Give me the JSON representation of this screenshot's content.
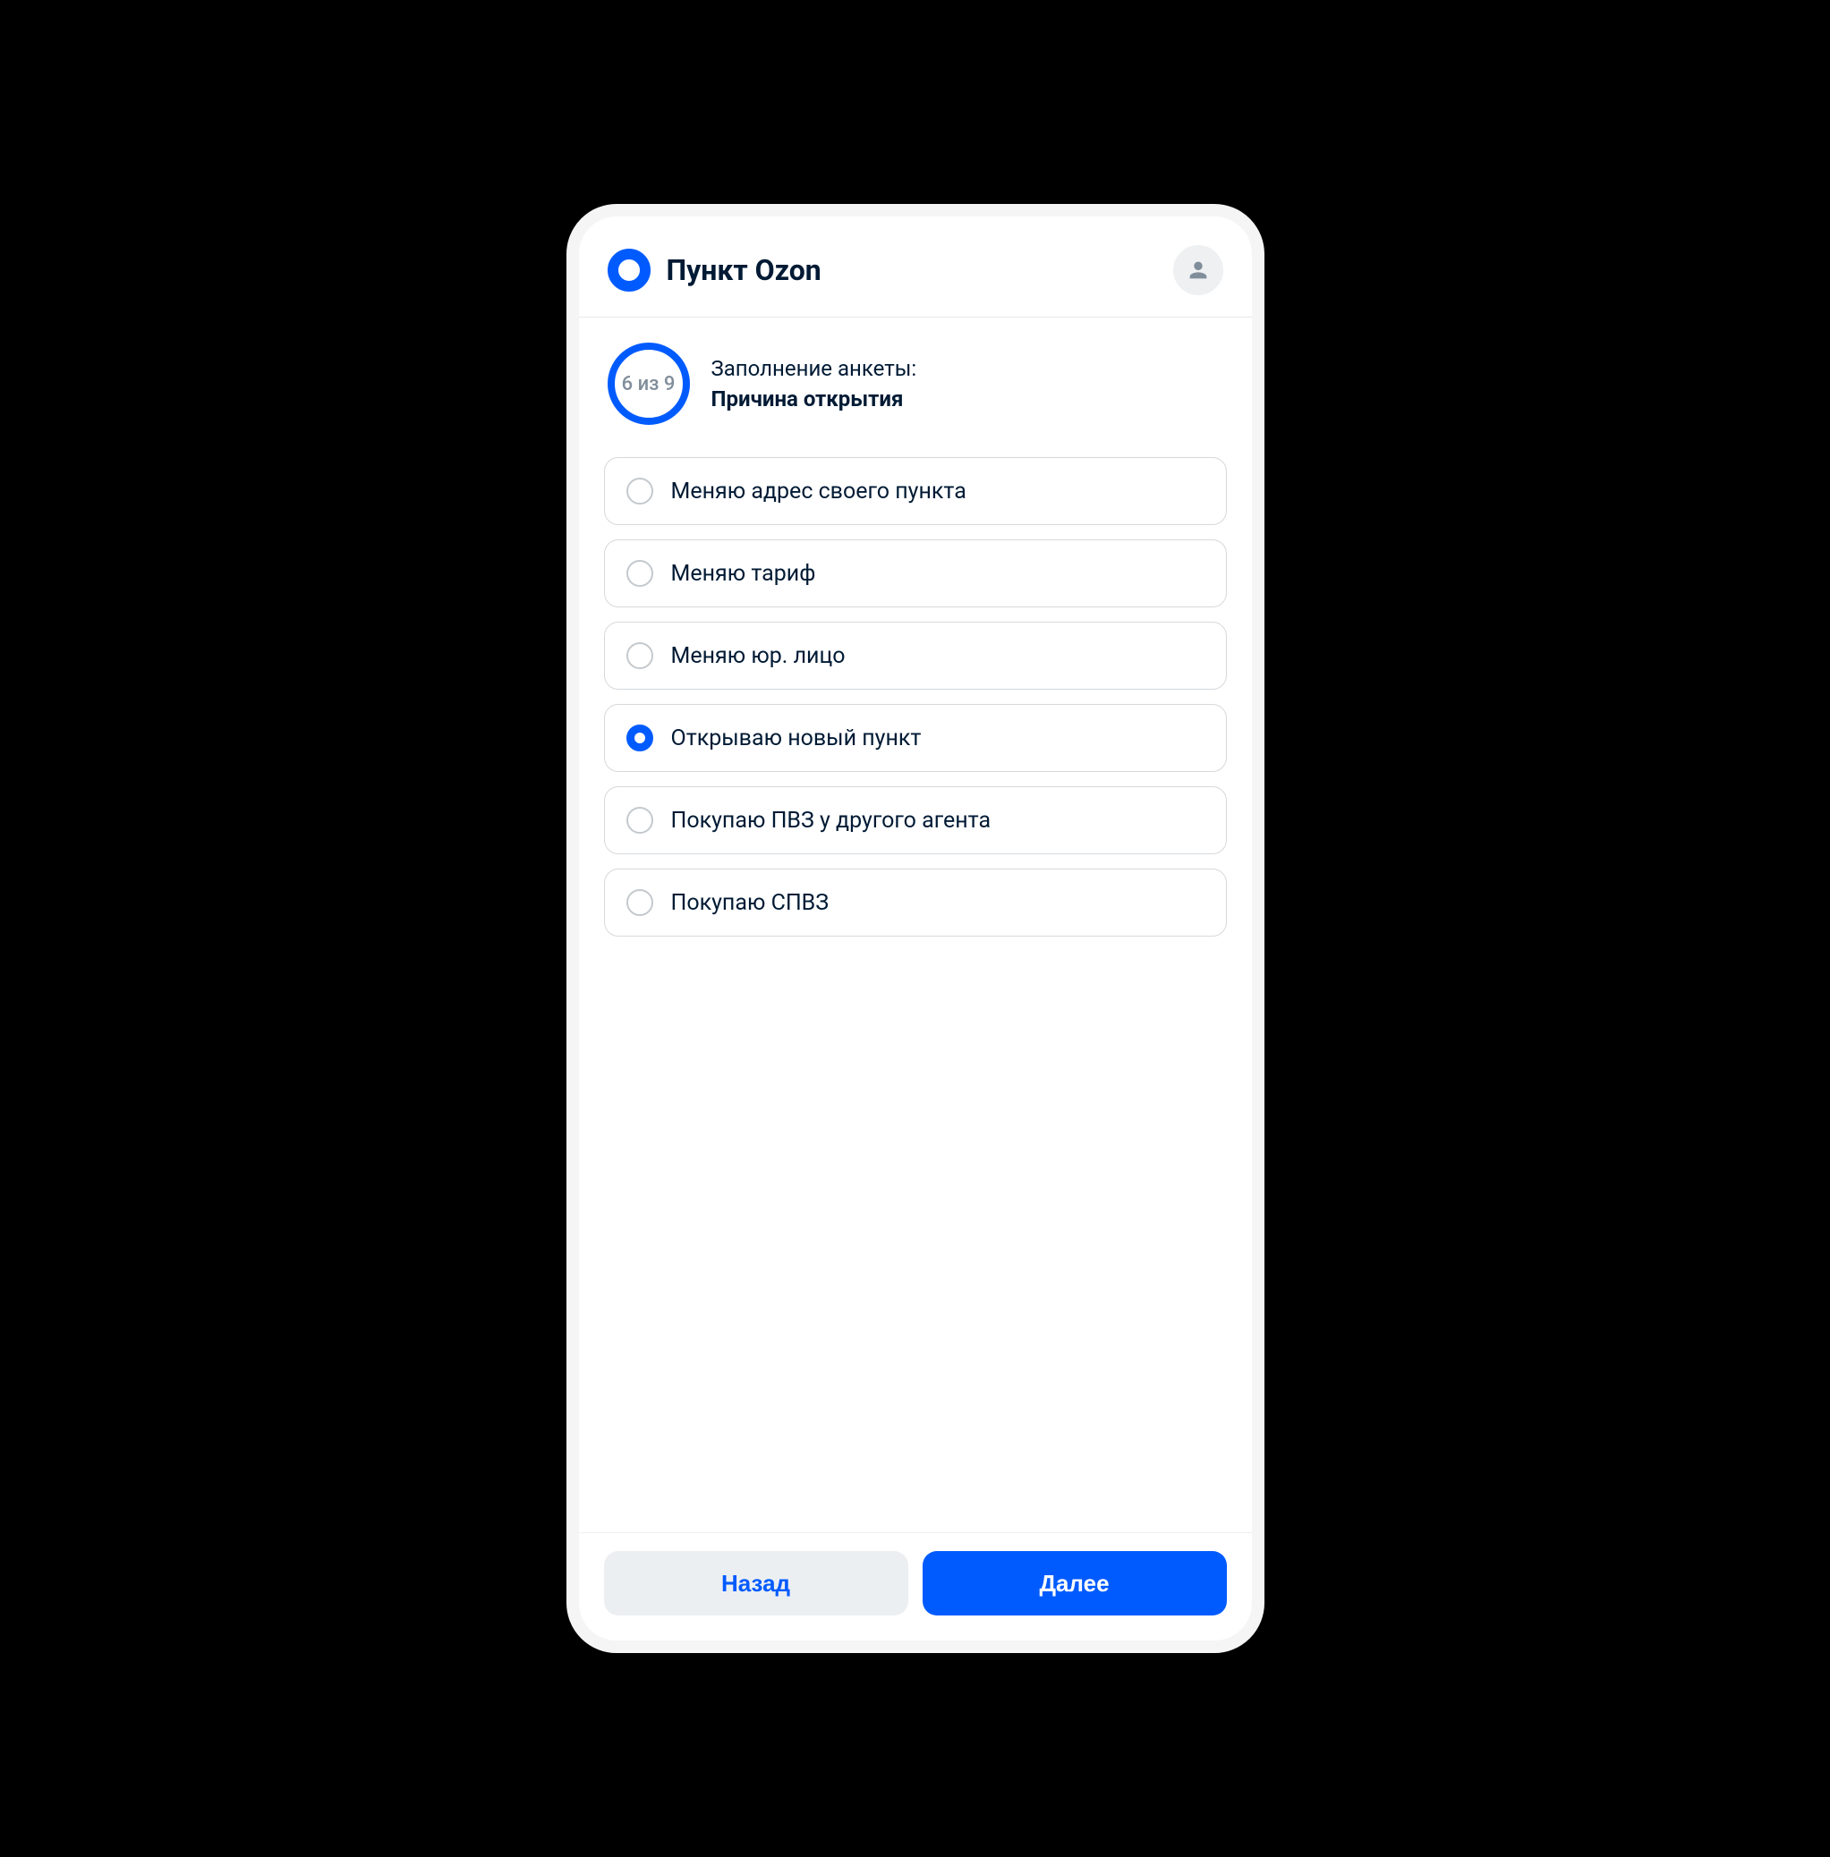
{
  "header": {
    "title": "Пункт Ozon"
  },
  "progress": {
    "counter": "6 из 9",
    "title": "Заполнение анкеты:",
    "subtitle": "Причина открытия"
  },
  "options": [
    {
      "label": "Меняю адрес своего пункта",
      "selected": false
    },
    {
      "label": "Меняю тариф",
      "selected": false
    },
    {
      "label": "Меняю юр. лицо",
      "selected": false
    },
    {
      "label": "Открываю новый пункт",
      "selected": true
    },
    {
      "label": "Покупаю ПВЗ у другого агента",
      "selected": false
    },
    {
      "label": "Покупаю СПВЗ",
      "selected": false
    }
  ],
  "footer": {
    "back": "Назад",
    "next": "Далее"
  }
}
